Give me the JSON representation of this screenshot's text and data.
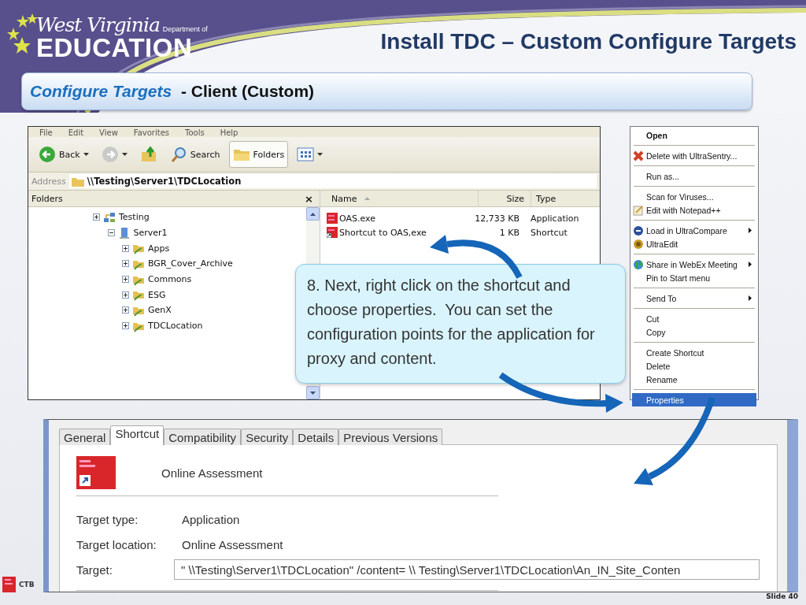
{
  "header": {
    "logo": {
      "script_text": "West Virginia",
      "department_text": "Department of",
      "wordmark": "EDUCATION"
    },
    "title": "Install TDC – Custom Configure Targets"
  },
  "subtitle": "*Configure Targets* - Client (Custom)",
  "explorer": {
    "menu": [
      "File",
      "Edit",
      "View",
      "Favorites",
      "Tools",
      "Help"
    ],
    "toolbar": [
      {
        "kind": "back",
        "label": "Back",
        "pressed": false
      },
      {
        "kind": "forward",
        "pressed": false
      },
      {
        "kind": "up",
        "pressed": false
      },
      {
        "kind": "search",
        "label": "Search",
        "pressed": false
      },
      {
        "kind": "folders",
        "label": "Folders",
        "pressed": true
      },
      {
        "kind": "views",
        "pressed": false
      }
    ],
    "address": {
      "label": "Address",
      "value": "\\\\Testing\\Server1\\TDCLocation"
    },
    "folders_pane": {
      "title": "Folders",
      "close": "×",
      "tree": [
        {
          "label": "Testing",
          "kind": "network",
          "expanded": false,
          "children": [
            {
              "label": "Server1",
              "kind": "server",
              "expanded": true,
              "children": [
                {
                  "label": "Apps",
                  "kind": "share",
                  "expanded": false
                },
                {
                  "label": "BGR_Cover_Archive",
                  "kind": "share",
                  "expanded": false
                },
                {
                  "label": "Commons",
                  "kind": "share",
                  "expanded": false
                },
                {
                  "label": "ESG",
                  "kind": "share",
                  "expanded": false
                },
                {
                  "label": "GenX",
                  "kind": "share",
                  "expanded": false
                },
                {
                  "label": "TDCLocation",
                  "kind": "share",
                  "expanded": false
                }
              ]
            }
          ]
        }
      ]
    },
    "file_list": {
      "columns": [
        {
          "label": "Name",
          "sorted": true
        },
        {
          "label": "Size",
          "sorted": false
        },
        {
          "label": "Type",
          "sorted": false
        }
      ],
      "rows": [
        {
          "name": "OAS.exe",
          "size": "12,733 KB",
          "type": "Application",
          "kind": "application"
        },
        {
          "name": "Shortcut to OAS,exe",
          "size": "1 KB",
          "type": "Shortcut",
          "kind": "shortcut"
        }
      ]
    }
  },
  "context_menu": {
    "groups": [
      [
        {
          "label": "Open",
          "kind": "plain",
          "default": true,
          "selected": false,
          "submenu": false
        }
      ],
      [
        {
          "label": "Delete with UltraSentry...",
          "kind": "delete",
          "default": false,
          "selected": false,
          "submenu": false
        }
      ],
      [
        {
          "label": "Run as...",
          "kind": "plain",
          "default": false,
          "selected": false,
          "submenu": false
        }
      ],
      [
        {
          "label": "Scan for Viruses...",
          "kind": "plain",
          "default": false,
          "selected": false,
          "submenu": false
        },
        {
          "label": "Edit with Notepad++",
          "kind": "notepad",
          "default": false,
          "selected": false,
          "submenu": false
        }
      ],
      [
        {
          "label": "Load in UltraCompare",
          "kind": "compare",
          "default": false,
          "selected": false,
          "submenu": true
        },
        {
          "label": "UltraEdit",
          "kind": "ultraedit",
          "default": false,
          "selected": false,
          "submenu": false
        }
      ],
      [
        {
          "label": "Share in WebEx Meeting",
          "kind": "globe",
          "default": false,
          "selected": false,
          "submenu": true
        },
        {
          "label": "Pin to Start menu",
          "kind": "plain",
          "default": false,
          "selected": false,
          "submenu": false
        }
      ],
      [
        {
          "label": "Send To",
          "kind": "plain",
          "default": false,
          "selected": false,
          "submenu": true
        }
      ],
      [
        {
          "label": "Cut",
          "kind": "plain",
          "default": false,
          "selected": false,
          "submenu": false
        },
        {
          "label": "Copy",
          "kind": "plain",
          "default": false,
          "selected": false,
          "submenu": false
        }
      ],
      [
        {
          "label": "Create Shortcut",
          "kind": "plain",
          "default": false,
          "selected": false,
          "submenu": false
        },
        {
          "label": "Delete",
          "kind": "plain",
          "default": false,
          "selected": false,
          "submenu": false
        },
        {
          "label": "Rename",
          "kind": "plain",
          "default": false,
          "selected": false,
          "submenu": false
        }
      ],
      [
        {
          "label": "Properties",
          "kind": "plain",
          "default": false,
          "selected": true,
          "submenu": false
        }
      ]
    ]
  },
  "callout": {
    "text": "8. Next, right click on the shortcut and choose properties.  You can set the configuration points for the application for proxy and content."
  },
  "dialog": {
    "tabs": [
      {
        "label": "General",
        "selected": false
      },
      {
        "label": "Shortcut",
        "selected": true
      },
      {
        "label": "Compatibility",
        "selected": false
      },
      {
        "label": "Security",
        "selected": false
      },
      {
        "label": "Details",
        "selected": false
      },
      {
        "label": "Previous Versions",
        "selected": false
      }
    ],
    "app_name": "Online Assessment",
    "fields": [
      {
        "label": "Target type:",
        "value": "Application",
        "kind": "text"
      },
      {
        "label": "Target location:",
        "value": "Online Assessment",
        "kind": "text"
      },
      {
        "label": "Target:",
        "value": "\" \\\\Testing\\Server1\\TDCLocation\" /content= \\\\ Testing\\Server1\\TDCLocation\\An_IN_Site_Conten",
        "kind": "input"
      }
    ]
  },
  "footer": {
    "brand": "CTB",
    "slide_number": "Slide 40"
  }
}
